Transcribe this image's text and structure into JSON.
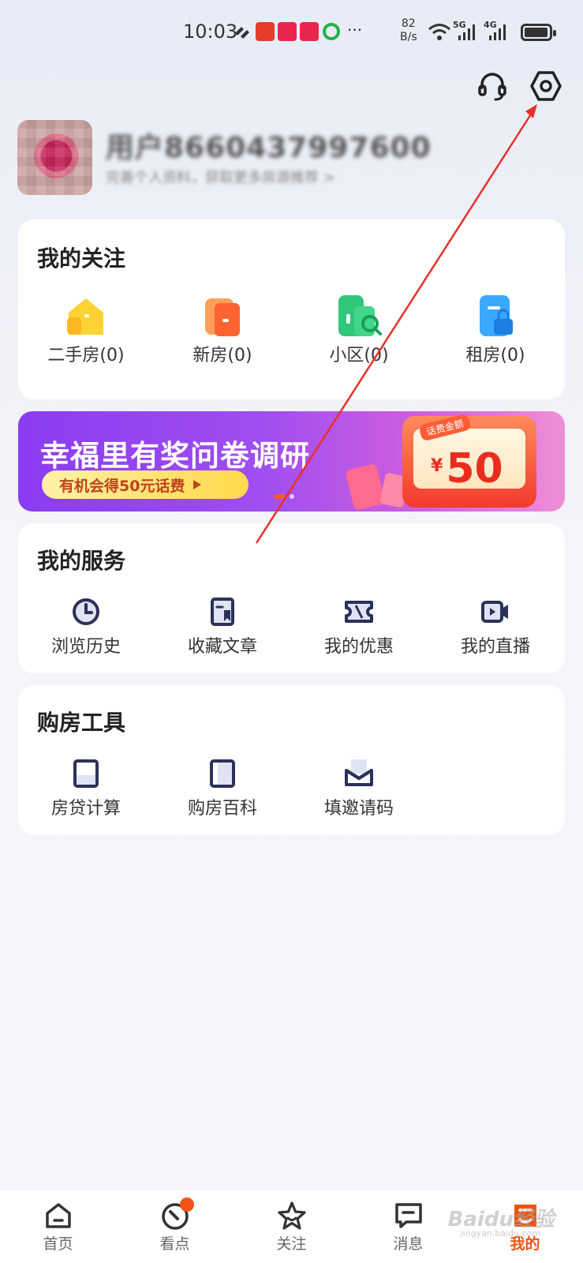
{
  "status_bar": {
    "time": "10:03",
    "net_speed_value": "82",
    "net_speed_unit": "B/s",
    "signal_5g": "5G",
    "signal_4g": "4G",
    "more": "···",
    "icon_colors": [
      "#e83b2a",
      "#e8264e",
      "#e8264e",
      "#22b34a"
    ]
  },
  "header": {
    "support_icon": "headset-icon",
    "settings_icon": "settings-hexagon-icon"
  },
  "profile": {
    "name": "用户8660437997600",
    "subtitle": "完善个人资料，获取更多房源推荐 >"
  },
  "follow_card": {
    "title": "我的关注",
    "items": [
      {
        "label": "二手房(0)",
        "icon": "house-icon",
        "color": "#ffcf2e"
      },
      {
        "label": "新房(0)",
        "icon": "building-icon",
        "color": "#ff7a3d"
      },
      {
        "label": "小区(0)",
        "icon": "community-search-icon",
        "color": "#2fc77a"
      },
      {
        "label": "租房(0)",
        "icon": "rent-lock-icon",
        "color": "#2f9bf5"
      }
    ]
  },
  "banner": {
    "title": "幸福里有奖问卷调研",
    "pill_text": "有机会得50元话费",
    "coupon_tag": "话费金额",
    "coupon_currency": "¥",
    "coupon_amount": "50"
  },
  "services_card": {
    "title": "我的服务",
    "items": [
      {
        "label": "浏览历史",
        "icon": "clock-icon"
      },
      {
        "label": "收藏文章",
        "icon": "bookmark-doc-icon"
      },
      {
        "label": "我的优惠",
        "icon": "ticket-icon"
      },
      {
        "label": "我的直播",
        "icon": "video-camera-icon"
      }
    ]
  },
  "tools_card": {
    "title": "购房工具",
    "items": [
      {
        "label": "房贷计算",
        "icon": "calculator-icon"
      },
      {
        "label": "购房百科",
        "icon": "book-icon"
      },
      {
        "label": "填邀请码",
        "icon": "envelope-icon"
      }
    ]
  },
  "bottom_nav": {
    "tabs": [
      {
        "label": "首页",
        "icon": "home-icon"
      },
      {
        "label": "看点",
        "icon": "compass-icon",
        "badge": true
      },
      {
        "label": "关注",
        "icon": "star-icon"
      },
      {
        "label": "消息",
        "icon": "message-icon"
      },
      {
        "label": "我的",
        "icon": "profile-icon",
        "active": true
      }
    ],
    "active_color": "#e95513"
  },
  "watermark": {
    "text": "Baidu经验",
    "sub": "jingyan.baidu.com"
  },
  "annotation_color": "#e8302a"
}
